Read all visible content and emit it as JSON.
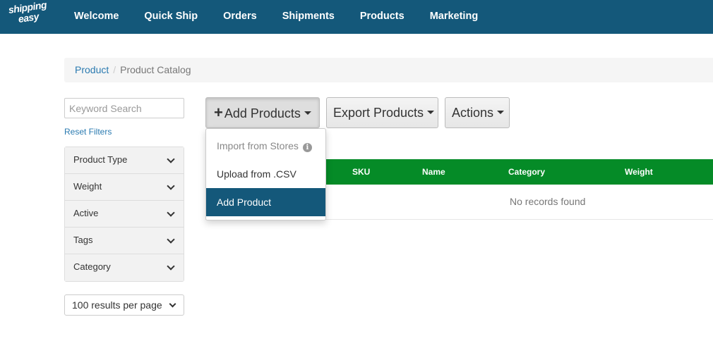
{
  "brand": {
    "logo_line1": "shipping",
    "logo_line2": "easy"
  },
  "nav": {
    "items": [
      "Welcome",
      "Quick Ship",
      "Orders",
      "Shipments",
      "Products",
      "Marketing"
    ]
  },
  "breadcrumb": {
    "parent": "Product",
    "separator": "/",
    "current": "Product Catalog"
  },
  "sidebar": {
    "search_placeholder": "Keyword Search",
    "reset_filters": "Reset Filters",
    "filters": [
      "Product Type",
      "Weight",
      "Active",
      "Tags",
      "Category"
    ],
    "per_page": "100 results per page"
  },
  "toolbar": {
    "add_products": "Add Products",
    "export_products": "Export Products",
    "actions": "Actions"
  },
  "add_menu": {
    "items": [
      "Import from Stores",
      "Upload from .CSV",
      "Add Product"
    ],
    "selected": "Add Product",
    "info_glyph": "i"
  },
  "table": {
    "columns": [
      "SKU",
      "Name",
      "Category",
      "Weight"
    ],
    "empty_message": "No records found"
  },
  "colors": {
    "nav_bg": "#14587a",
    "table_header": "#058b27",
    "link": "#2a7ab0",
    "menu_selected": "#14587a"
  }
}
